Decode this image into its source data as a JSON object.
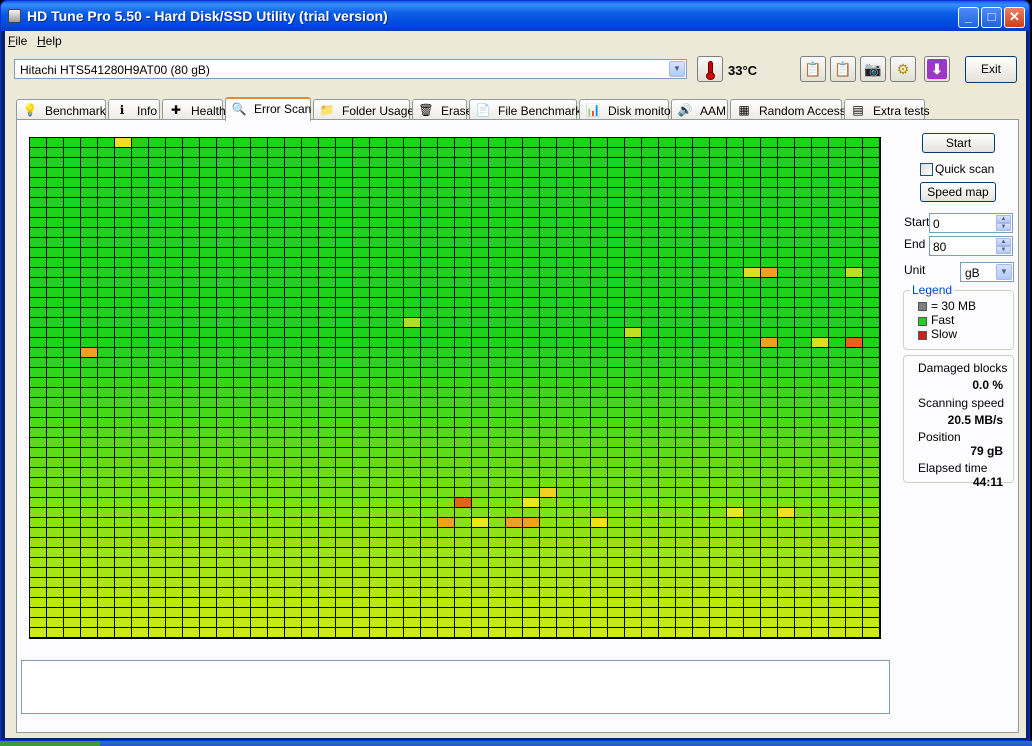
{
  "window": {
    "title": "HD Tune Pro 5.50 - Hard Disk/SSD Utility (trial version)",
    "controls": {
      "minimize": "_",
      "maximize": "□",
      "close": "✕"
    }
  },
  "menu": [
    {
      "label_first": "F",
      "label_rest": "ile"
    },
    {
      "label_first": "H",
      "label_rest": "elp"
    }
  ],
  "toolbar": {
    "drive": "Hitachi HTS541280H9AT00 (80 gB)",
    "temperature": "33°C",
    "exit_label": "Exit",
    "icons": [
      "copy-text-icon",
      "copy-image-icon",
      "camera-icon",
      "options-icon",
      "save-icon"
    ]
  },
  "tabs": [
    {
      "label": "Benchmark",
      "icon": "lightbulb-icon",
      "glyph": "💡"
    },
    {
      "label": "Info",
      "icon": "info-icon",
      "glyph": "ℹ"
    },
    {
      "label": "Health",
      "icon": "health-cross-icon",
      "glyph": "✚"
    },
    {
      "label": "Error Scan",
      "icon": "magnifier-icon",
      "glyph": "🔍",
      "active": true
    },
    {
      "label": "Folder Usage",
      "icon": "folder-icon",
      "glyph": "📁"
    },
    {
      "label": "Erase",
      "icon": "trash-icon",
      "glyph": "🗑"
    },
    {
      "label": "File Benchmark",
      "icon": "file-benchmark-icon",
      "glyph": "📄"
    },
    {
      "label": "Disk monitor",
      "icon": "monitor-chart-icon",
      "glyph": "📊"
    },
    {
      "label": "AAM",
      "icon": "speaker-icon",
      "glyph": "🔊"
    },
    {
      "label": "Random Access",
      "icon": "random-access-icon",
      "glyph": "▦"
    },
    {
      "label": "Extra tests",
      "icon": "extra-tests-icon",
      "glyph": "▤"
    }
  ],
  "controls": {
    "start_button": "Start",
    "quick_scan_label": "Quick scan",
    "quick_scan_checked": false,
    "speed_map_button": "Speed map",
    "start_label": "Start",
    "start_value": "0",
    "end_label": "End",
    "end_value": "80",
    "unit_label": "Unit",
    "unit_value": "gB"
  },
  "legend": {
    "title": "Legend",
    "items": [
      {
        "label": "= 30 MB",
        "color": "#808080"
      },
      {
        "label": "Fast",
        "color": "#1ed21e"
      },
      {
        "label": "Slow",
        "color": "#d21e1e"
      }
    ]
  },
  "stats": {
    "damaged_label": "Damaged blocks",
    "damaged_value": "0.0 %",
    "speed_label": "Scanning speed",
    "speed_value": "20.5 MB/s",
    "position_label": "Position",
    "position_value": "79 gB",
    "elapsed_label": "Elapsed time",
    "elapsed_value": "44:11"
  },
  "scan_map": {
    "columns": 50,
    "rows": 50,
    "fast_color": "#1ed21e",
    "slow_color": "#d21e1e",
    "highlights": [
      {
        "row": 0,
        "col": 5,
        "color": "#f0e020"
      },
      {
        "row": 13,
        "col": 42,
        "color": "#d8e020"
      },
      {
        "row": 13,
        "col": 43,
        "color": "#f0a020"
      },
      {
        "row": 13,
        "col": 48,
        "color": "#b8e020"
      },
      {
        "row": 18,
        "col": 22,
        "color": "#b0e020"
      },
      {
        "row": 19,
        "col": 35,
        "color": "#c0e020"
      },
      {
        "row": 20,
        "col": 43,
        "color": "#f0a020"
      },
      {
        "row": 20,
        "col": 46,
        "color": "#d8e020"
      },
      {
        "row": 20,
        "col": 48,
        "color": "#e86020"
      },
      {
        "row": 21,
        "col": 3,
        "color": "#f0a020"
      },
      {
        "row": 36,
        "col": 25,
        "color": "#e86020"
      },
      {
        "row": 36,
        "col": 29,
        "color": "#e8e820"
      },
      {
        "row": 35,
        "col": 30,
        "color": "#f0d020"
      },
      {
        "row": 37,
        "col": 41,
        "color": "#e8e820"
      },
      {
        "row": 37,
        "col": 44,
        "color": "#f0e020"
      },
      {
        "row": 38,
        "col": 24,
        "color": "#f0a020"
      },
      {
        "row": 38,
        "col": 26,
        "color": "#e8e820"
      },
      {
        "row": 38,
        "col": 28,
        "color": "#f0a020"
      },
      {
        "row": 38,
        "col": 29,
        "color": "#f0a020"
      },
      {
        "row": 38,
        "col": 33,
        "color": "#f0e020"
      }
    ]
  }
}
